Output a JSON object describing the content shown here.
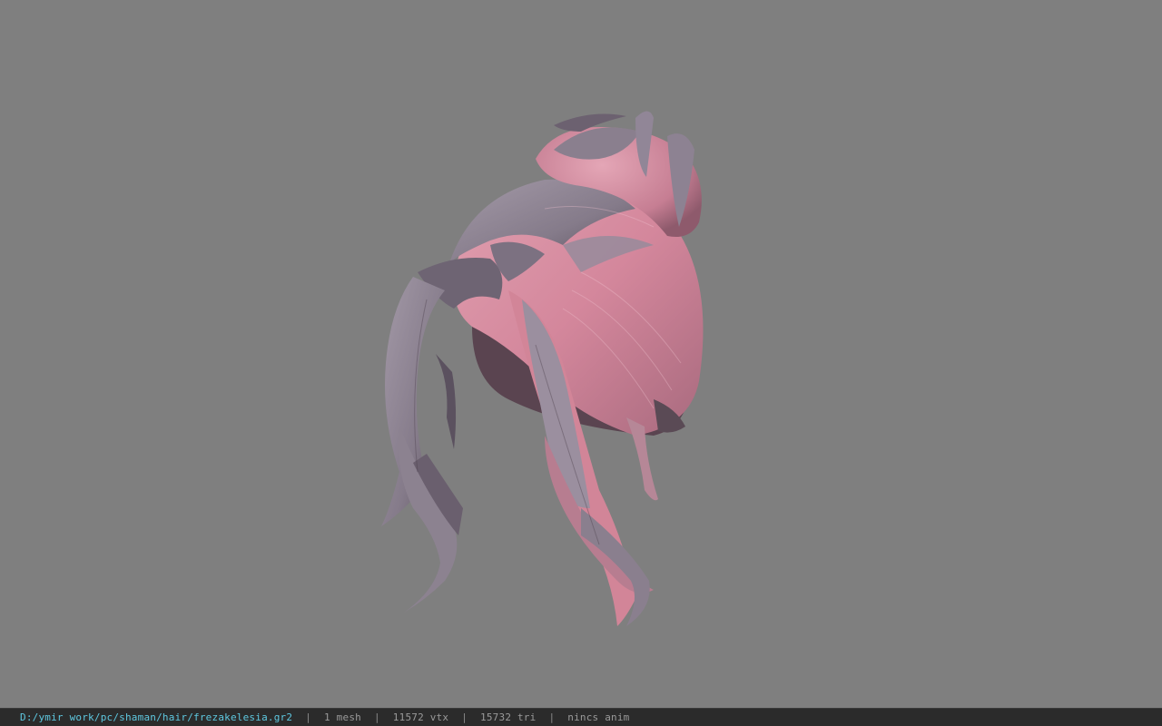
{
  "viewer": {
    "background_color": "#7f7f7f",
    "model_name": "hair-model-viewport",
    "colors": {
      "hair_pink": "#d48a9c",
      "hair_grey": "#8f8593",
      "hair_shadow": "#4a3f4a"
    }
  },
  "statusbar": {
    "file_path": "D:/ymir work/pc/shaman/hair/frezakelesia.gr2",
    "separator": "|",
    "mesh_count": "1 mesh",
    "vertex_count": "11572 vtx",
    "triangle_count": "15732 tri",
    "anim_status": "nincs anim",
    "path_color": "#5ec8e0"
  }
}
